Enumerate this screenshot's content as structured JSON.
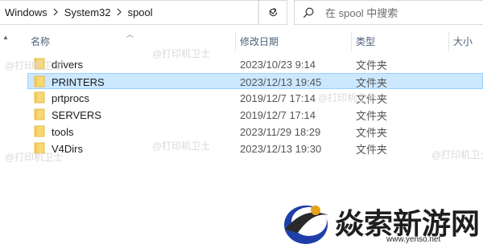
{
  "address_bar": {
    "breadcrumbs": [
      "Windows",
      "System32",
      "spool"
    ]
  },
  "search": {
    "placeholder": "在 spool 中搜索"
  },
  "columns": {
    "name": "名称",
    "date": "修改日期",
    "type": "类型",
    "size": "大小"
  },
  "files": [
    {
      "name": "drivers",
      "date": "2023/10/23 9:14",
      "type": "文件夹",
      "selected": false
    },
    {
      "name": "PRINTERS",
      "date": "2023/12/13 19:45",
      "type": "文件夹",
      "selected": true
    },
    {
      "name": "prtprocs",
      "date": "2019/12/7 17:14",
      "type": "文件夹",
      "selected": false
    },
    {
      "name": "SERVERS",
      "date": "2019/12/7 17:14",
      "type": "文件夹",
      "selected": false
    },
    {
      "name": "tools",
      "date": "2023/11/29 18:29",
      "type": "文件夹",
      "selected": false
    },
    {
      "name": "V4Dirs",
      "date": "2023/12/13 19:30",
      "type": "文件夹",
      "selected": false
    }
  ],
  "watermark": "@打印机卫士",
  "logo": {
    "text": "焱索新游网",
    "url": "www.yenso.net"
  },
  "colors": {
    "selection_bg": "#cce8ff",
    "selection_border": "#99d1ff",
    "folder": "#f8d775",
    "header_text": "#4c607a"
  },
  "icons": [
    "chevron-right-icon",
    "chevron-down-icon",
    "refresh-icon",
    "search-icon",
    "folder-icon",
    "scroll-up-icon",
    "sort-up-icon"
  ]
}
